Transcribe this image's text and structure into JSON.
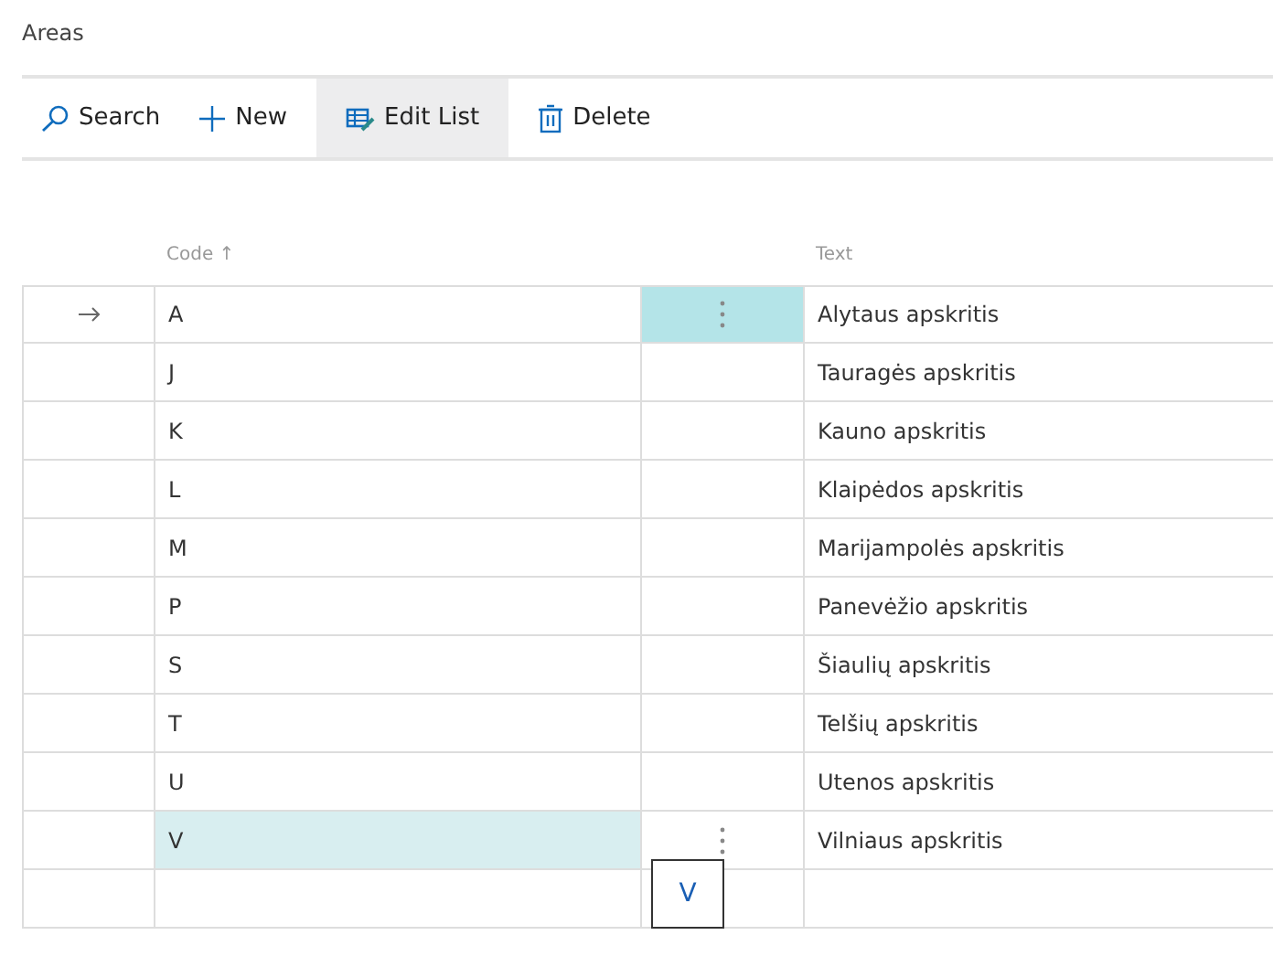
{
  "page_title": "Areas",
  "toolbar": [
    {
      "kind": "search",
      "label": "Search",
      "selected": false
    },
    {
      "kind": "new",
      "label": "New",
      "selected": false
    },
    {
      "kind": "edit",
      "label": "Edit List",
      "selected": true
    },
    {
      "kind": "delete",
      "label": "Delete",
      "selected": false
    }
  ],
  "table": {
    "columns": [
      {
        "label": "Code",
        "sort": "↑"
      },
      {
        "label": "Text"
      }
    ],
    "rows": [
      {
        "code": "A",
        "text": "Alytaus apskritis",
        "current": true,
        "highlighted": false
      },
      {
        "code": "J",
        "text": "Tauragės apskritis",
        "current": false,
        "highlighted": false
      },
      {
        "code": "K",
        "text": "Kauno apskritis",
        "current": false,
        "highlighted": false
      },
      {
        "code": "L",
        "text": "Klaipėdos apskritis",
        "current": false,
        "highlighted": false
      },
      {
        "code": "M",
        "text": "Marijampolės apskritis",
        "current": false,
        "highlighted": false
      },
      {
        "code": "P",
        "text": "Panevėžio apskritis",
        "current": false,
        "highlighted": false
      },
      {
        "code": "S",
        "text": "Šiaulių apskritis",
        "current": false,
        "highlighted": false
      },
      {
        "code": "T",
        "text": "Telšių apskritis",
        "current": false,
        "highlighted": false
      },
      {
        "code": "U",
        "text": "Utenos apskritis",
        "current": false,
        "highlighted": false
      },
      {
        "code": "V",
        "text": "Vilniaus apskritis",
        "current": false,
        "highlighted": true
      }
    ],
    "new_row": true
  },
  "tooltip": {
    "text": "V"
  }
}
